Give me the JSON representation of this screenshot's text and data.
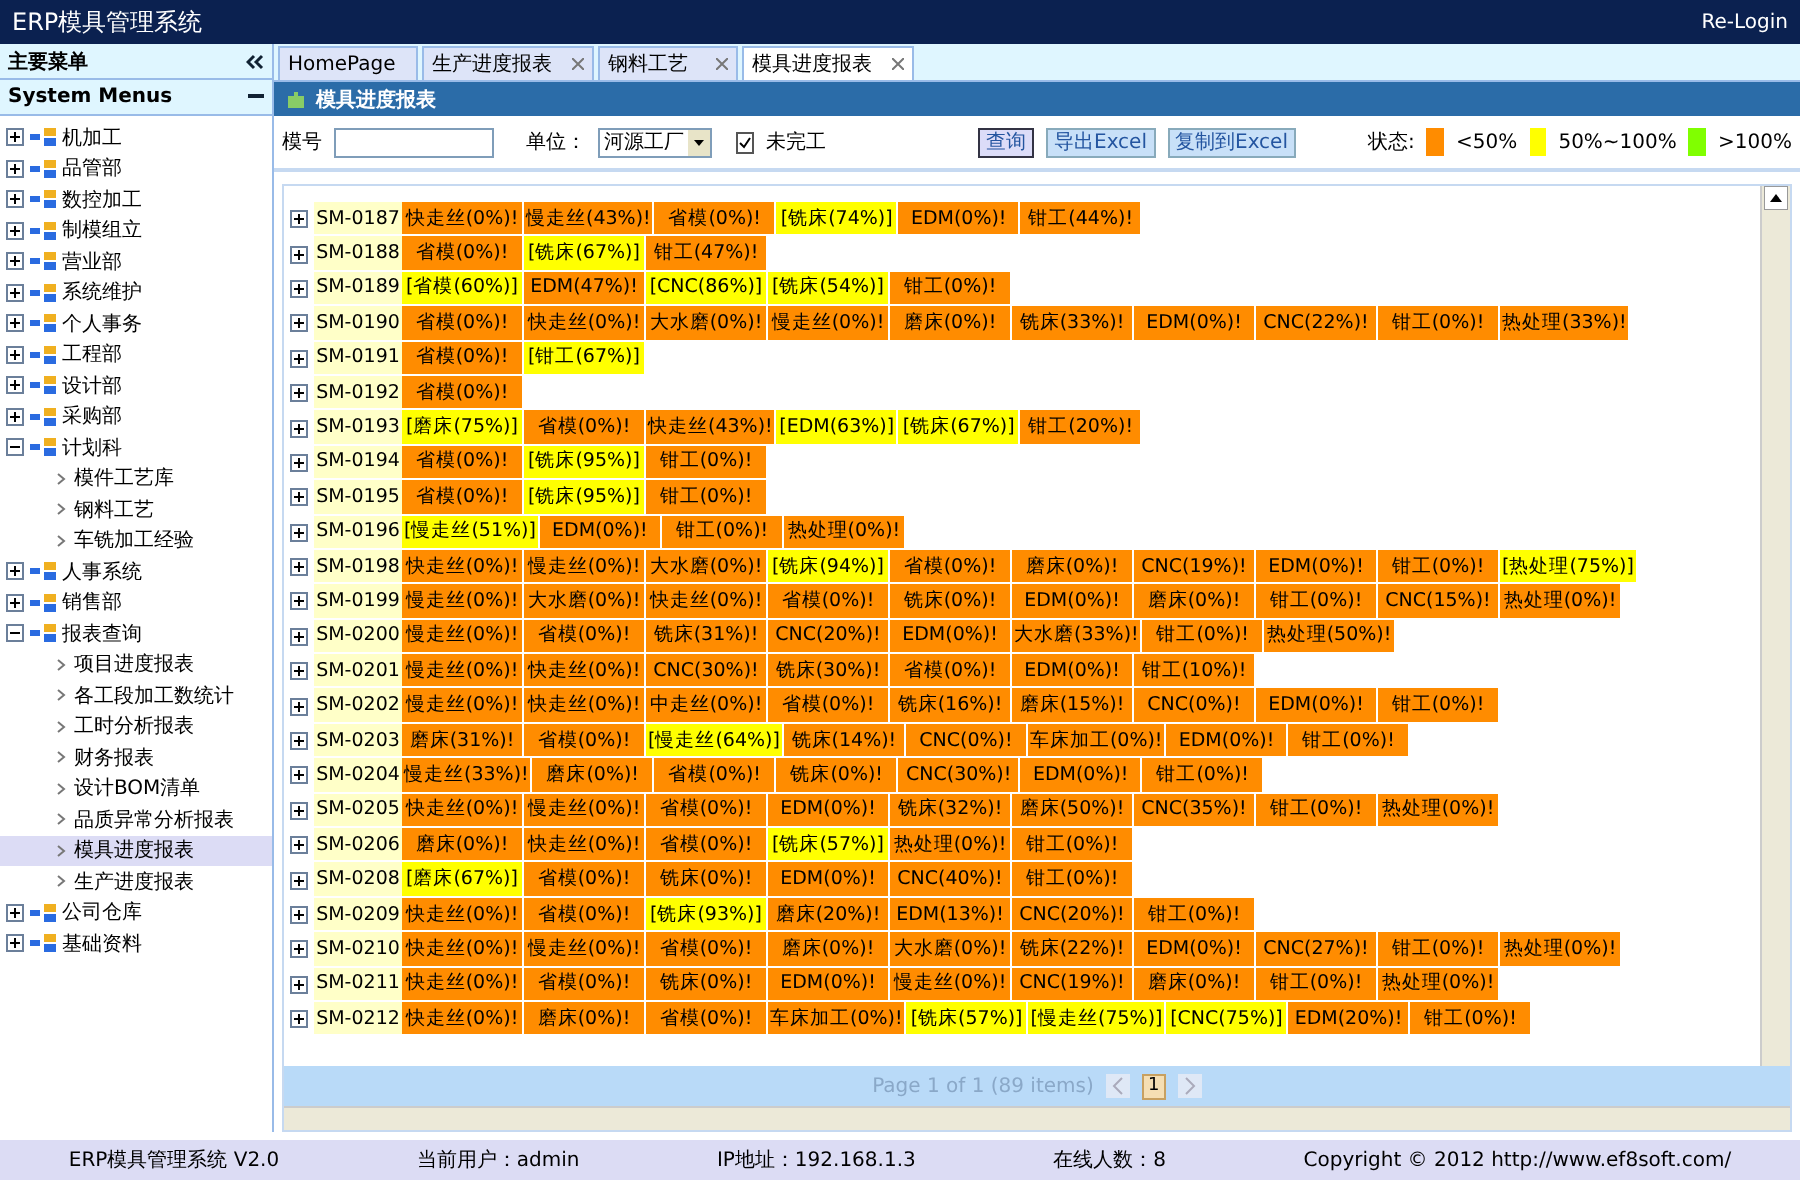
{
  "app": {
    "title": "ERP模具管理系统",
    "relogin": "Re-Login"
  },
  "sidebar": {
    "header": "主要菜单",
    "menu_title": "System Menus",
    "items": [
      {
        "label": "机加工",
        "expanded": false
      },
      {
        "label": "品管部",
        "expanded": false
      },
      {
        "label": "数控加工",
        "expanded": false
      },
      {
        "label": "制模组立",
        "expanded": false
      },
      {
        "label": "营业部",
        "expanded": false
      },
      {
        "label": "系统维护",
        "expanded": false
      },
      {
        "label": "个人事务",
        "expanded": false
      },
      {
        "label": "工程部",
        "expanded": false
      },
      {
        "label": "设计部",
        "expanded": false
      },
      {
        "label": "采购部",
        "expanded": false
      },
      {
        "label": "计划科",
        "expanded": true,
        "children": [
          {
            "label": "模件工艺库",
            "selected": false
          },
          {
            "label": "钢料工艺",
            "selected": false
          },
          {
            "label": "车铣加工经验",
            "selected": false
          }
        ]
      },
      {
        "label": "人事系统",
        "expanded": false
      },
      {
        "label": "销售部",
        "expanded": false
      },
      {
        "label": "报表查询",
        "expanded": true,
        "children": [
          {
            "label": "项目进度报表",
            "selected": false
          },
          {
            "label": "各工段加工数统计",
            "selected": false
          },
          {
            "label": "工时分析报表",
            "selected": false
          },
          {
            "label": "财务报表",
            "selected": false
          },
          {
            "label": "设计BOM清单",
            "selected": false
          },
          {
            "label": "品质异常分析报表",
            "selected": false
          },
          {
            "label": "模具进度报表",
            "selected": true
          },
          {
            "label": "生产进度报表",
            "selected": false
          }
        ]
      },
      {
        "label": "公司仓库",
        "expanded": false
      },
      {
        "label": "基础资料",
        "expanded": false
      }
    ]
  },
  "tabs": [
    {
      "label": "HomePage",
      "selected": false,
      "closable": false
    },
    {
      "label": "生产进度报表",
      "selected": false,
      "closable": true
    },
    {
      "label": "钢料工艺",
      "selected": false,
      "closable": true
    },
    {
      "label": "模具进度报表",
      "selected": true,
      "closable": true
    }
  ],
  "panel": {
    "title": "模具进度报表"
  },
  "filters": {
    "mold_label": "模号",
    "unit_label": "单位：",
    "unit_value": "河源工厂",
    "unfinished_label": "未完工",
    "unfinished_checked": true,
    "buttons": [
      "查询",
      "导出Excel",
      "复制到Excel"
    ],
    "status_label": "状态:"
  },
  "legend": [
    {
      "color": "#ff8c00",
      "label": "<50%"
    },
    {
      "color": "#ffff00",
      "label": "50%~100%"
    },
    {
      "color": "#80ff00",
      "label": ">100%"
    }
  ],
  "grid": {
    "rows": [
      {
        "id": "SM-0187",
        "cells": [
          {
            "text": "快走丝(0%)!",
            "color": "#ff8c00"
          },
          {
            "text": "慢走丝(43%)!",
            "color": "#ff8c00"
          },
          {
            "text": "省模(0%)!",
            "color": "#ff8c00"
          },
          {
            "text": "[铣床(74%)]",
            "color": "#ffff00"
          },
          {
            "text": "EDM(0%)!",
            "color": "#ff8c00"
          },
          {
            "text": "钳工(44%)!",
            "color": "#ff8c00"
          }
        ]
      },
      {
        "id": "SM-0188",
        "cells": [
          {
            "text": "省模(0%)!",
            "color": "#ff8c00"
          },
          {
            "text": "[铣床(67%)]",
            "color": "#ffff00"
          },
          {
            "text": "钳工(47%)!",
            "color": "#ff8c00"
          }
        ]
      },
      {
        "id": "SM-0189",
        "cells": [
          {
            "text": "[省模(60%)]",
            "color": "#ffff00"
          },
          {
            "text": "EDM(47%)!",
            "color": "#ff8c00"
          },
          {
            "text": "[CNC(86%)]",
            "color": "#ffff00"
          },
          {
            "text": "[铣床(54%)]",
            "color": "#ffff00"
          },
          {
            "text": "钳工(0%)!",
            "color": "#ff8c00"
          }
        ]
      },
      {
        "id": "SM-0190",
        "cells": [
          {
            "text": "省模(0%)!",
            "color": "#ff8c00"
          },
          {
            "text": "快走丝(0%)!",
            "color": "#ff8c00"
          },
          {
            "text": "大水磨(0%)!",
            "color": "#ff8c00"
          },
          {
            "text": "慢走丝(0%)!",
            "color": "#ff8c00"
          },
          {
            "text": "磨床(0%)!",
            "color": "#ff8c00"
          },
          {
            "text": "铣床(33%)!",
            "color": "#ff8c00"
          },
          {
            "text": "EDM(0%)!",
            "color": "#ff8c00"
          },
          {
            "text": "CNC(22%)!",
            "color": "#ff8c00"
          },
          {
            "text": "钳工(0%)!",
            "color": "#ff8c00"
          },
          {
            "text": "热处理(33%)!",
            "color": "#ff8c00"
          }
        ]
      },
      {
        "id": "SM-0191",
        "cells": [
          {
            "text": "省模(0%)!",
            "color": "#ff8c00"
          },
          {
            "text": "[钳工(67%)]",
            "color": "#ffff00"
          }
        ]
      },
      {
        "id": "SM-0192",
        "cells": [
          {
            "text": "省模(0%)!",
            "color": "#ff8c00"
          }
        ]
      },
      {
        "id": "SM-0193",
        "cells": [
          {
            "text": "[磨床(75%)]",
            "color": "#ffff00"
          },
          {
            "text": "省模(0%)!",
            "color": "#ff8c00"
          },
          {
            "text": "快走丝(43%)!",
            "color": "#ff8c00"
          },
          {
            "text": "[EDM(63%)]",
            "color": "#ffff00"
          },
          {
            "text": "[铣床(67%)]",
            "color": "#ffff00"
          },
          {
            "text": "钳工(20%)!",
            "color": "#ff8c00"
          }
        ]
      },
      {
        "id": "SM-0194",
        "cells": [
          {
            "text": "省模(0%)!",
            "color": "#ff8c00"
          },
          {
            "text": "[铣床(95%)]",
            "color": "#ffff00"
          },
          {
            "text": "钳工(0%)!",
            "color": "#ff8c00"
          }
        ]
      },
      {
        "id": "SM-0195",
        "cells": [
          {
            "text": "省模(0%)!",
            "color": "#ff8c00"
          },
          {
            "text": "[铣床(95%)]",
            "color": "#ffff00"
          },
          {
            "text": "钳工(0%)!",
            "color": "#ff8c00"
          }
        ]
      },
      {
        "id": "SM-0196",
        "cells": [
          {
            "text": "[慢走丝(51%)]",
            "color": "#ffff00"
          },
          {
            "text": "EDM(0%)!",
            "color": "#ff8c00"
          },
          {
            "text": "钳工(0%)!",
            "color": "#ff8c00"
          },
          {
            "text": "热处理(0%)!",
            "color": "#ff8c00"
          }
        ]
      },
      {
        "id": "SM-0198",
        "cells": [
          {
            "text": "快走丝(0%)!",
            "color": "#ff8c00"
          },
          {
            "text": "慢走丝(0%)!",
            "color": "#ff8c00"
          },
          {
            "text": "大水磨(0%)!",
            "color": "#ff8c00"
          },
          {
            "text": "[铣床(94%)]",
            "color": "#ffff00"
          },
          {
            "text": "省模(0%)!",
            "color": "#ff8c00"
          },
          {
            "text": "磨床(0%)!",
            "color": "#ff8c00"
          },
          {
            "text": "CNC(19%)!",
            "color": "#ff8c00"
          },
          {
            "text": "EDM(0%)!",
            "color": "#ff8c00"
          },
          {
            "text": "钳工(0%)!",
            "color": "#ff8c00"
          },
          {
            "text": "[热处理(75%)]",
            "color": "#ffff00"
          }
        ]
      },
      {
        "id": "SM-0199",
        "cells": [
          {
            "text": "慢走丝(0%)!",
            "color": "#ff8c00"
          },
          {
            "text": "大水磨(0%)!",
            "color": "#ff8c00"
          },
          {
            "text": "快走丝(0%)!",
            "color": "#ff8c00"
          },
          {
            "text": "省模(0%)!",
            "color": "#ff8c00"
          },
          {
            "text": "铣床(0%)!",
            "color": "#ff8c00"
          },
          {
            "text": "EDM(0%)!",
            "color": "#ff8c00"
          },
          {
            "text": "磨床(0%)!",
            "color": "#ff8c00"
          },
          {
            "text": "钳工(0%)!",
            "color": "#ff8c00"
          },
          {
            "text": "CNC(15%)!",
            "color": "#ff8c00"
          },
          {
            "text": "热处理(0%)!",
            "color": "#ff8c00"
          }
        ]
      },
      {
        "id": "SM-0200",
        "cells": [
          {
            "text": "慢走丝(0%)!",
            "color": "#ff8c00"
          },
          {
            "text": "省模(0%)!",
            "color": "#ff8c00"
          },
          {
            "text": "铣床(31%)!",
            "color": "#ff8c00"
          },
          {
            "text": "CNC(20%)!",
            "color": "#ff8c00"
          },
          {
            "text": "EDM(0%)!",
            "color": "#ff8c00"
          },
          {
            "text": "大水磨(33%)!",
            "color": "#ff8c00"
          },
          {
            "text": "钳工(0%)!",
            "color": "#ff8c00"
          },
          {
            "text": "热处理(50%)!",
            "color": "#ff8c00"
          }
        ]
      },
      {
        "id": "SM-0201",
        "cells": [
          {
            "text": "慢走丝(0%)!",
            "color": "#ff8c00"
          },
          {
            "text": "快走丝(0%)!",
            "color": "#ff8c00"
          },
          {
            "text": "CNC(30%)!",
            "color": "#ff8c00"
          },
          {
            "text": "铣床(30%)!",
            "color": "#ff8c00"
          },
          {
            "text": "省模(0%)!",
            "color": "#ff8c00"
          },
          {
            "text": "EDM(0%)!",
            "color": "#ff8c00"
          },
          {
            "text": "钳工(10%)!",
            "color": "#ff8c00"
          }
        ]
      },
      {
        "id": "SM-0202",
        "cells": [
          {
            "text": "慢走丝(0%)!",
            "color": "#ff8c00"
          },
          {
            "text": "快走丝(0%)!",
            "color": "#ff8c00"
          },
          {
            "text": "中走丝(0%)!",
            "color": "#ff8c00"
          },
          {
            "text": "省模(0%)!",
            "color": "#ff8c00"
          },
          {
            "text": "铣床(16%)!",
            "color": "#ff8c00"
          },
          {
            "text": "磨床(15%)!",
            "color": "#ff8c00"
          },
          {
            "text": "CNC(0%)!",
            "color": "#ff8c00"
          },
          {
            "text": "EDM(0%)!",
            "color": "#ff8c00"
          },
          {
            "text": "钳工(0%)!",
            "color": "#ff8c00"
          }
        ]
      },
      {
        "id": "SM-0203",
        "cells": [
          {
            "text": "磨床(31%)!",
            "color": "#ff8c00"
          },
          {
            "text": "省模(0%)!",
            "color": "#ff8c00"
          },
          {
            "text": "[慢走丝(64%)]",
            "color": "#ffff00"
          },
          {
            "text": "铣床(14%)!",
            "color": "#ff8c00"
          },
          {
            "text": "CNC(0%)!",
            "color": "#ff8c00"
          },
          {
            "text": "车床加工(0%)!",
            "color": "#ff8c00"
          },
          {
            "text": "EDM(0%)!",
            "color": "#ff8c00"
          },
          {
            "text": "钳工(0%)!",
            "color": "#ff8c00"
          }
        ]
      },
      {
        "id": "SM-0204",
        "cells": [
          {
            "text": "慢走丝(33%)!",
            "color": "#ff8c00"
          },
          {
            "text": "磨床(0%)!",
            "color": "#ff8c00"
          },
          {
            "text": "省模(0%)!",
            "color": "#ff8c00"
          },
          {
            "text": "铣床(0%)!",
            "color": "#ff8c00"
          },
          {
            "text": "CNC(30%)!",
            "color": "#ff8c00"
          },
          {
            "text": "EDM(0%)!",
            "color": "#ff8c00"
          },
          {
            "text": "钳工(0%)!",
            "color": "#ff8c00"
          }
        ]
      },
      {
        "id": "SM-0205",
        "cells": [
          {
            "text": "快走丝(0%)!",
            "color": "#ff8c00"
          },
          {
            "text": "慢走丝(0%)!",
            "color": "#ff8c00"
          },
          {
            "text": "省模(0%)!",
            "color": "#ff8c00"
          },
          {
            "text": "EDM(0%)!",
            "color": "#ff8c00"
          },
          {
            "text": "铣床(32%)!",
            "color": "#ff8c00"
          },
          {
            "text": "磨床(50%)!",
            "color": "#ff8c00"
          },
          {
            "text": "CNC(35%)!",
            "color": "#ff8c00"
          },
          {
            "text": "钳工(0%)!",
            "color": "#ff8c00"
          },
          {
            "text": "热处理(0%)!",
            "color": "#ff8c00"
          }
        ]
      },
      {
        "id": "SM-0206",
        "cells": [
          {
            "text": "磨床(0%)!",
            "color": "#ff8c00"
          },
          {
            "text": "快走丝(0%)!",
            "color": "#ff8c00"
          },
          {
            "text": "省模(0%)!",
            "color": "#ff8c00"
          },
          {
            "text": "[铣床(57%)]",
            "color": "#ffff00"
          },
          {
            "text": "热处理(0%)!",
            "color": "#ff8c00"
          },
          {
            "text": "钳工(0%)!",
            "color": "#ff8c00"
          }
        ]
      },
      {
        "id": "SM-0208",
        "cells": [
          {
            "text": "[磨床(67%)]",
            "color": "#ffff00"
          },
          {
            "text": "省模(0%)!",
            "color": "#ff8c00"
          },
          {
            "text": "铣床(0%)!",
            "color": "#ff8c00"
          },
          {
            "text": "EDM(0%)!",
            "color": "#ff8c00"
          },
          {
            "text": "CNC(40%)!",
            "color": "#ff8c00"
          },
          {
            "text": "钳工(0%)!",
            "color": "#ff8c00"
          }
        ]
      },
      {
        "id": "SM-0209",
        "cells": [
          {
            "text": "快走丝(0%)!",
            "color": "#ff8c00"
          },
          {
            "text": "省模(0%)!",
            "color": "#ff8c00"
          },
          {
            "text": "[铣床(93%)]",
            "color": "#ffff00"
          },
          {
            "text": "磨床(20%)!",
            "color": "#ff8c00"
          },
          {
            "text": "EDM(13%)!",
            "color": "#ff8c00"
          },
          {
            "text": "CNC(20%)!",
            "color": "#ff8c00"
          },
          {
            "text": "钳工(0%)!",
            "color": "#ff8c00"
          }
        ]
      },
      {
        "id": "SM-0210",
        "cells": [
          {
            "text": "快走丝(0%)!",
            "color": "#ff8c00"
          },
          {
            "text": "慢走丝(0%)!",
            "color": "#ff8c00"
          },
          {
            "text": "省模(0%)!",
            "color": "#ff8c00"
          },
          {
            "text": "磨床(0%)!",
            "color": "#ff8c00"
          },
          {
            "text": "大水磨(0%)!",
            "color": "#ff8c00"
          },
          {
            "text": "铣床(22%)!",
            "color": "#ff8c00"
          },
          {
            "text": "EDM(0%)!",
            "color": "#ff8c00"
          },
          {
            "text": "CNC(27%)!",
            "color": "#ff8c00"
          },
          {
            "text": "钳工(0%)!",
            "color": "#ff8c00"
          },
          {
            "text": "热处理(0%)!",
            "color": "#ff8c00"
          }
        ]
      },
      {
        "id": "SM-0211",
        "cells": [
          {
            "text": "快走丝(0%)!",
            "color": "#ff8c00"
          },
          {
            "text": "省模(0%)!",
            "color": "#ff8c00"
          },
          {
            "text": "铣床(0%)!",
            "color": "#ff8c00"
          },
          {
            "text": "EDM(0%)!",
            "color": "#ff8c00"
          },
          {
            "text": "慢走丝(0%)!",
            "color": "#ff8c00"
          },
          {
            "text": "CNC(19%)!",
            "color": "#ff8c00"
          },
          {
            "text": "磨床(0%)!",
            "color": "#ff8c00"
          },
          {
            "text": "钳工(0%)!",
            "color": "#ff8c00"
          },
          {
            "text": "热处理(0%)!",
            "color": "#ff8c00"
          }
        ]
      },
      {
        "id": "SM-0212",
        "cells": [
          {
            "text": "快走丝(0%)!",
            "color": "#ff8c00"
          },
          {
            "text": "磨床(0%)!",
            "color": "#ff8c00"
          },
          {
            "text": "省模(0%)!",
            "color": "#ff8c00"
          },
          {
            "text": "车床加工(0%)!",
            "color": "#ff8c00"
          },
          {
            "text": "[铣床(57%)]",
            "color": "#ffff00"
          },
          {
            "text": "[慢走丝(75%)]",
            "color": "#ffff00"
          },
          {
            "text": "[CNC(75%)]",
            "color": "#ffff00"
          },
          {
            "text": "EDM(20%)!",
            "color": "#ff8c00"
          },
          {
            "text": "钳工(0%)!",
            "color": "#ff8c00"
          }
        ]
      }
    ]
  },
  "pager": {
    "summary": "Page 1 of 1 (89 items)",
    "page": "1"
  },
  "footer": [
    "ERP模具管理系统 V2.0",
    "当前用户：admin",
    "IP地址：192.168.1.3",
    "在线人数：8",
    "Copyright © 2012 http://www.ef8soft.com/"
  ]
}
